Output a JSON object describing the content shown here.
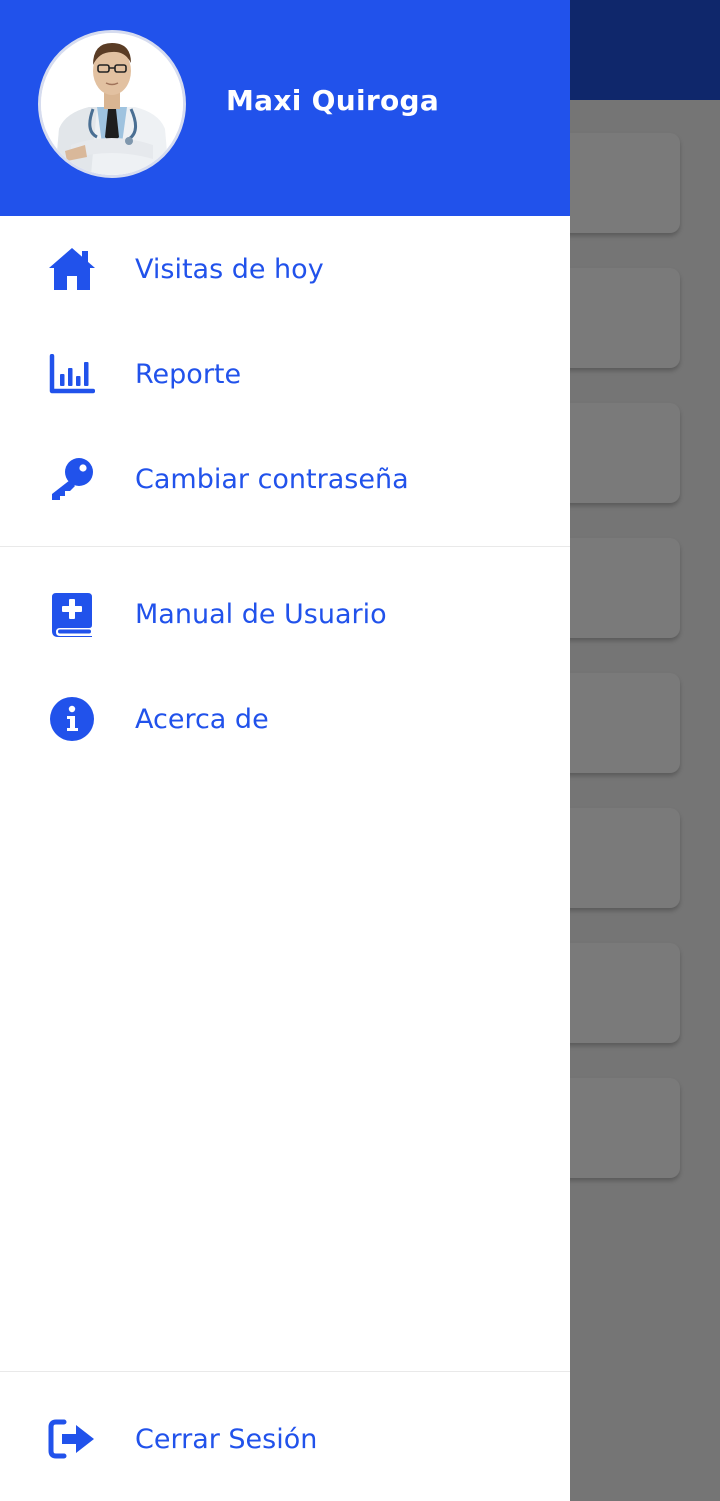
{
  "colors": {
    "primary": "#2152eb",
    "appbar": "#0f276b",
    "scrim": "#757575"
  },
  "header": {
    "user_name": "Maxi Quiroga",
    "avatar": "doctor-avatar"
  },
  "menu": {
    "primary_items": [
      {
        "label": "Visitas de hoy",
        "icon": "home-icon"
      },
      {
        "label": "Reporte",
        "icon": "bar-chart-icon"
      },
      {
        "label": "Cambiar contraseña",
        "icon": "key-icon"
      }
    ],
    "secondary_items": [
      {
        "label": "Manual de Usuario",
        "icon": "medical-book-icon"
      },
      {
        "label": "Acerca de",
        "icon": "info-icon"
      }
    ],
    "footer_item": {
      "label": "Cerrar Sesión",
      "icon": "logout-icon"
    }
  }
}
